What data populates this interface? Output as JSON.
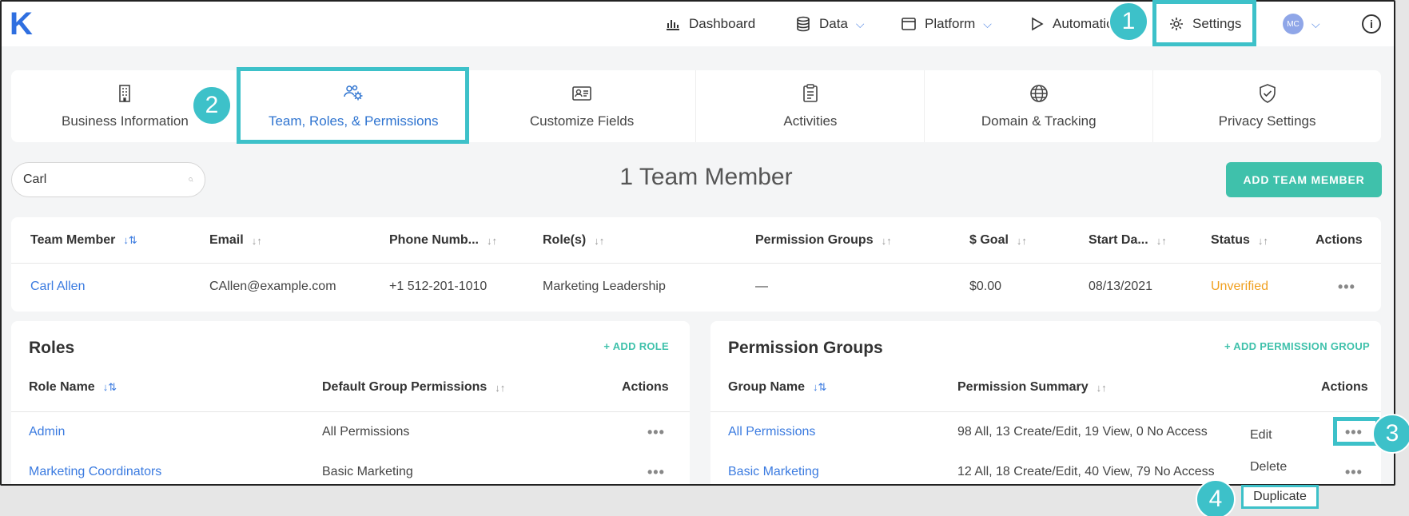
{
  "app": {
    "logo": "K"
  },
  "nav": {
    "dashboard": "Dashboard",
    "data": "Data",
    "platform": "Platform",
    "automation": "Automatio",
    "settings": "Settings",
    "avatar": "MC",
    "info": "i"
  },
  "tabs": [
    {
      "label": "Business Information",
      "icon": "building-icon"
    },
    {
      "label": "Team, Roles, & Permissions",
      "icon": "team-settings-icon"
    },
    {
      "label": "Customize Fields",
      "icon": "id-card-icon"
    },
    {
      "label": "Activities",
      "icon": "clipboard-icon"
    },
    {
      "label": "Domain & Tracking",
      "icon": "globe-icon"
    },
    {
      "label": "Privacy Settings",
      "icon": "shield-check-icon"
    }
  ],
  "search": {
    "value": "Carl",
    "placeholder": "Search"
  },
  "member_count": "1 Team Member",
  "add_member_label": "ADD TEAM MEMBER",
  "members_table": {
    "headers": [
      "Team Member",
      "Email",
      "Phone Numb...",
      "Role(s)",
      "Permission Groups",
      "$ Goal",
      "Start Da...",
      "Status",
      "Actions"
    ],
    "rows": [
      {
        "name": "Carl Allen",
        "email": "CAllen@example.com",
        "phone": "+1 512-201-1010",
        "role": "Marketing Leadership",
        "groups": "—",
        "goal": "$0.00",
        "start": "08/13/2021",
        "status": "Unverified",
        "actions": "•••"
      }
    ]
  },
  "roles": {
    "title": "Roles",
    "add_label": "+ ADD ROLE",
    "headers": [
      "Role Name",
      "Default Group Permissions",
      "Actions"
    ],
    "rows": [
      {
        "name": "Admin",
        "permissions": "All Permissions",
        "actions": "•••"
      },
      {
        "name": "Marketing Coordinators",
        "permissions": "Basic Marketing",
        "actions": "•••"
      }
    ]
  },
  "permission_groups": {
    "title": "Permission Groups",
    "add_label": "+ ADD PERMISSION GROUP",
    "headers": [
      "Group Name",
      "Permission Summary",
      "Actions"
    ],
    "rows": [
      {
        "name": "All Permissions",
        "summary": "98 All, 13 Create/Edit, 19 View, 0 No Access",
        "actions": "•••"
      },
      {
        "name": "Basic Marketing",
        "summary": "12 All, 18 Create/Edit, 40 View, 79 No Access",
        "actions": "•••"
      }
    ]
  },
  "dropdown": {
    "edit": "Edit",
    "delete": "Delete",
    "duplicate": "Duplicate"
  },
  "callouts": [
    "1",
    "2",
    "3",
    "4"
  ],
  "colors": {
    "accent": "#3fc1ab",
    "link": "#3b7be0",
    "highlight": "#3dc1c9",
    "warning": "#f0a020"
  }
}
